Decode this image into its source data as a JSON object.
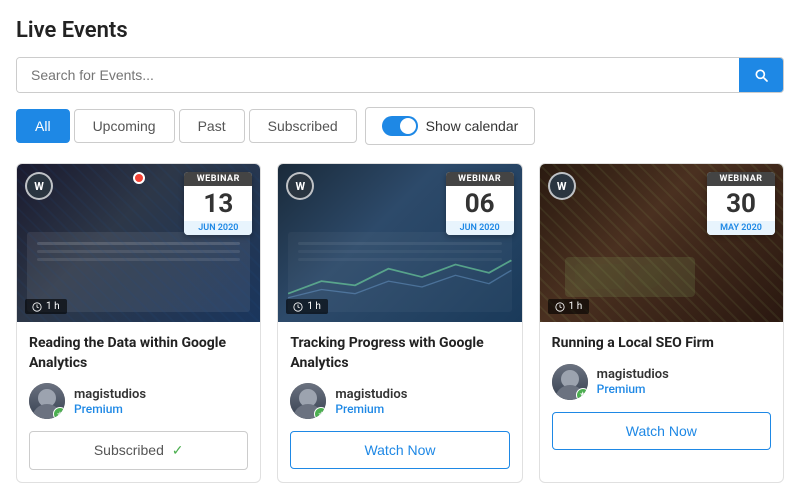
{
  "page": {
    "title": "Live Events"
  },
  "search": {
    "placeholder": "Search for Events..."
  },
  "filters": {
    "all_label": "All",
    "upcoming_label": "Upcoming",
    "past_label": "Past",
    "subscribed_label": "Subscribed",
    "show_calendar_label": "Show calendar",
    "active": "All"
  },
  "events": [
    {
      "id": 1,
      "type": "WEBINAR",
      "date_day": "13",
      "date_month": "JUN 2020",
      "duration": "1 h",
      "title": "Reading the Data within Google Analytics",
      "author_name": "magistudios",
      "author_tier": "Premium",
      "action": "Subscribed",
      "action_type": "subscribed",
      "has_notification": true,
      "image_style": "analytics"
    },
    {
      "id": 2,
      "type": "WEBINAR",
      "date_day": "06",
      "date_month": "JUN 2020",
      "duration": "1 h",
      "title": "Tracking Progress with Google Analytics",
      "author_name": "magistudios",
      "author_tier": "Premium",
      "action": "Watch Now",
      "action_type": "watch-now",
      "has_notification": false,
      "image_style": "tracking"
    },
    {
      "id": 3,
      "type": "WEBINAR",
      "date_day": "30",
      "date_month": "MAY 2020",
      "duration": "1 h",
      "title": "Running a Local SEO Firm",
      "author_name": "magistudios",
      "author_tier": "Premium",
      "action": "Watch Now",
      "action_type": "watch-now",
      "has_notification": false,
      "image_style": "seo"
    }
  ]
}
